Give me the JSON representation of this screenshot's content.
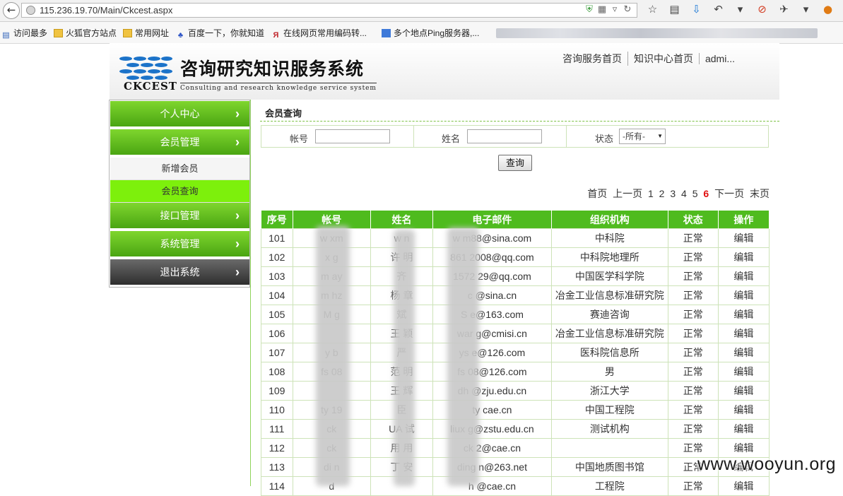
{
  "browser": {
    "url": "115.236.19.70/Main/Ckcest.aspx",
    "bookmarks": [
      {
        "icon": "frequent-icon",
        "label": "访问最多"
      },
      {
        "icon": "folder-icon",
        "label": "火狐官方站点"
      },
      {
        "icon": "folder-icon",
        "label": "常用网址"
      },
      {
        "icon": "baidu-paw-icon",
        "label": "百度一下，你就知道"
      },
      {
        "icon": "encode-tool-icon",
        "label": "在线网页常用编码转..."
      },
      {
        "icon": "ping-icon",
        "label": "多个地点Ping服务器,..."
      }
    ]
  },
  "header": {
    "title": "咨询研究知识服务系统",
    "subtitle": "Consulting and research knowledge service system",
    "logo_text": "CKCEST",
    "nav": [
      "咨询服务首页",
      "知识中心首页",
      "admi..."
    ]
  },
  "sidebar": {
    "personal": "个人中心",
    "member_mgmt": "会员管理",
    "sub_add": "新增会员",
    "sub_query": "会员查询",
    "api_mgmt": "接口管理",
    "sys_mgmt": "系统管理",
    "logout": "退出系统",
    "arrow": "›"
  },
  "main": {
    "title": "会员查询",
    "search": {
      "account_label": "帐号",
      "name_label": "姓名",
      "status_label": "状态",
      "account_value": "",
      "name_value": "",
      "status_value": "-所有-"
    },
    "query_button": "查询"
  },
  "pager": {
    "first": "首页",
    "prev": "上一页",
    "pages": [
      "1",
      "2",
      "3",
      "4",
      "5"
    ],
    "current": "6",
    "next": "下一页",
    "last": "末页"
  },
  "table": {
    "headers": [
      "序号",
      "帐号",
      "姓名",
      "电子邮件",
      "组织机构",
      "状态",
      "操作"
    ],
    "rows": [
      [
        "101",
        "w xm",
        "w n",
        "w m88@sina.com",
        "中科院",
        "正常",
        "编辑"
      ],
      [
        "102",
        "x g",
        "许 明",
        "861 2008@qq.com",
        "中科院地理所",
        "正常",
        "编辑"
      ],
      [
        "103",
        "m ay",
        "齐",
        "1572 29@qq.com",
        "中国医学科学院",
        "正常",
        "编辑"
      ],
      [
        "104",
        "m hz",
        "杨 章",
        "c @sina.cn",
        "冶金工业信息标准研究院",
        "正常",
        "编辑"
      ],
      [
        "105",
        "M g",
        "斌",
        "S e@163.com",
        "赛迪咨询",
        "正常",
        "编辑"
      ],
      [
        "106",
        "",
        "王 颖",
        "war g@cmisi.cn",
        "冶金工业信息标准研究院",
        "正常",
        "编辑"
      ],
      [
        "107",
        "y b",
        "严",
        "ys e@126.com",
        "医科院信息所",
        "正常",
        "编辑"
      ],
      [
        "108",
        "fs 08",
        "范 明",
        "fs 08@126.com",
        "男",
        "正常",
        "编辑"
      ],
      [
        "109",
        "",
        "王 辉",
        "dh @zju.edu.cn",
        "浙江大学",
        "正常",
        "编辑"
      ],
      [
        "110",
        "ty 19",
        "臣",
        "ty cae.cn",
        "中国工程院",
        "正常",
        "编辑"
      ],
      [
        "111",
        "ck",
        "UA 试",
        "liux g@zstu.edu.cn",
        "测试机构",
        "正常",
        "编辑"
      ],
      [
        "112",
        "ck",
        "用 用",
        "ck 2@cae.cn",
        "",
        "正常",
        "编辑"
      ],
      [
        "113",
        "di n",
        "丁 安",
        "ding n@263.net",
        "中国地质图书馆",
        "正常",
        "编辑"
      ],
      [
        "114",
        "d",
        "",
        "h @cae.cn",
        "工程院",
        "正常",
        "编辑"
      ]
    ]
  },
  "watermark": "www.wooyun.org",
  "colors": {
    "accent_green": "#4fbb1e",
    "active_item": "#7df00c",
    "current_page": "#e01010"
  }
}
